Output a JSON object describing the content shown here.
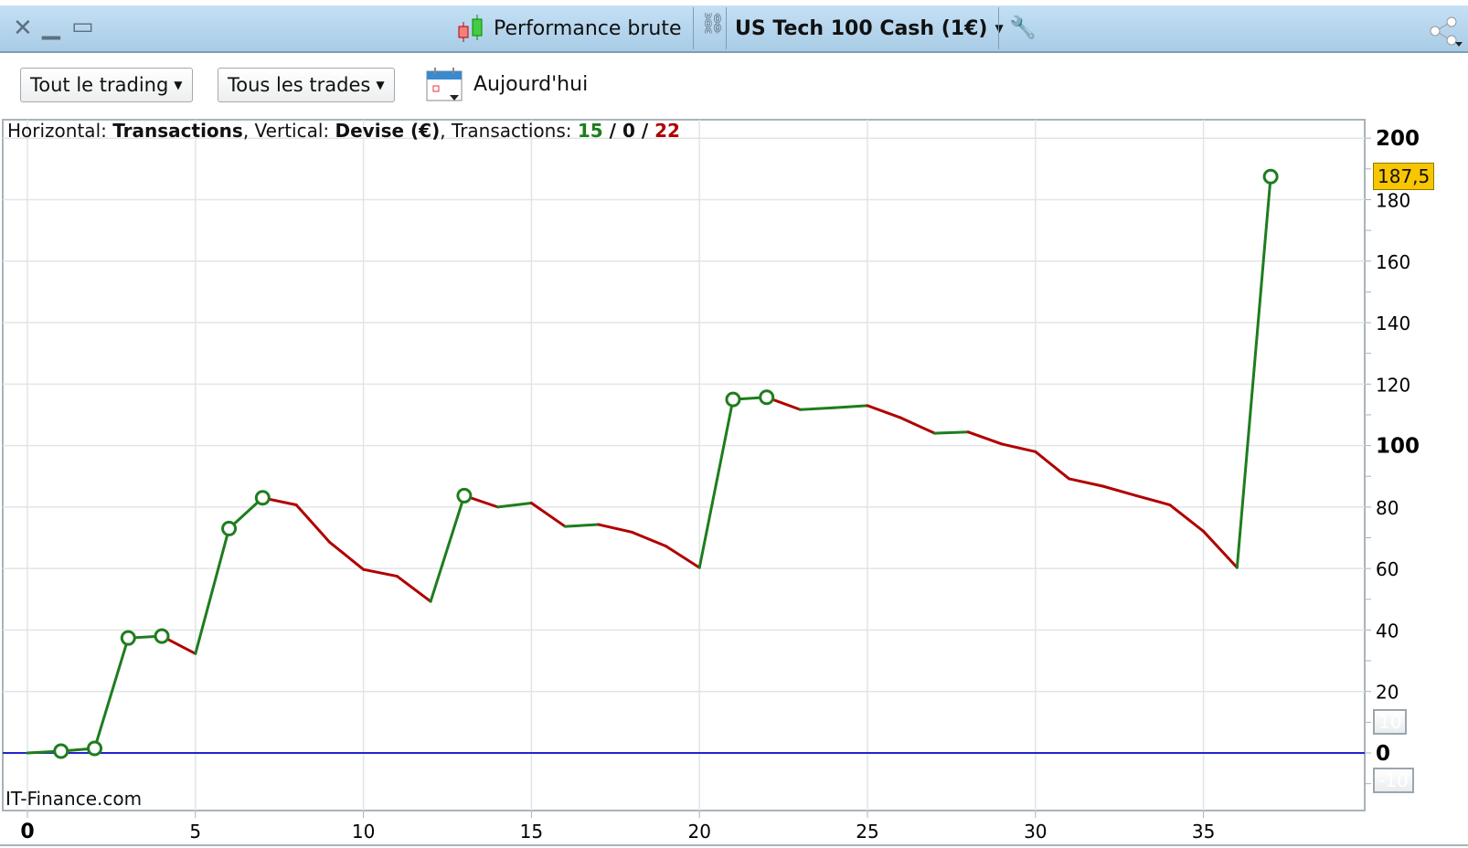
{
  "window": {
    "title": "Performance brute",
    "instrument": "US Tech 100 Cash (1€)",
    "icons": [
      "close-icon",
      "minimize-icon",
      "maximize-icon",
      "candlestick-icon",
      "link-icon",
      "wrench-icon",
      "share-icon"
    ]
  },
  "toolbar": {
    "scope": "Tout le trading",
    "trades": "Tous les trades",
    "date": "Aujourd'hui"
  },
  "info": {
    "h_label": "Horizontal: ",
    "h_value": "Transactions",
    "v_label": ", Vertical: ",
    "v_value": "Devise (€)",
    "t_label": ", Transactions: ",
    "wins": "15",
    "sep1": " / ",
    "neutral": "0",
    "sep2": " / ",
    "losses": "22"
  },
  "watermark": "IT-Finance.com",
  "scale_buttons": {
    "up": "10",
    "down": "-10"
  },
  "colors": {
    "up": "#1e7d1e",
    "down": "#b00000",
    "zero_line": "#2222cc",
    "last_value_bg": "#f7c600"
  },
  "chart_data": {
    "type": "line",
    "xlabel": "Transactions",
    "ylabel": "Devise (€)",
    "xlim": [
      0,
      39.5
    ],
    "ylim": [
      -18,
      205
    ],
    "xticks": [
      0,
      5,
      10,
      15,
      20,
      25,
      30,
      35
    ],
    "yticks": [
      0,
      20,
      40,
      60,
      80,
      100,
      120,
      140,
      160,
      180,
      200
    ],
    "x": [
      0,
      1,
      2,
      3,
      4,
      5,
      6,
      7,
      8,
      9,
      10,
      11,
      12,
      13,
      14,
      15,
      16,
      17,
      18,
      19,
      20,
      21,
      22,
      23,
      24,
      25,
      26,
      27,
      28,
      29,
      30,
      31,
      32,
      33,
      34,
      35,
      36,
      37
    ],
    "y": [
      0,
      0.6,
      1.5,
      37.4,
      38,
      32.3,
      73,
      83,
      80.7,
      68.5,
      59.7,
      57.5,
      49.3,
      83.7,
      80,
      81.3,
      73.7,
      74.3,
      71.8,
      67.3,
      60.3,
      115,
      115.7,
      111.7,
      112.3,
      113,
      109,
      104,
      104.4,
      100.5,
      98,
      89.2,
      86.8,
      83.7,
      80.7,
      72.1,
      60.3,
      187.5
    ],
    "peak_markers": [
      1,
      2,
      3,
      4,
      6,
      7,
      13,
      21,
      22,
      37
    ],
    "last_value": "187,5",
    "grid": true
  }
}
